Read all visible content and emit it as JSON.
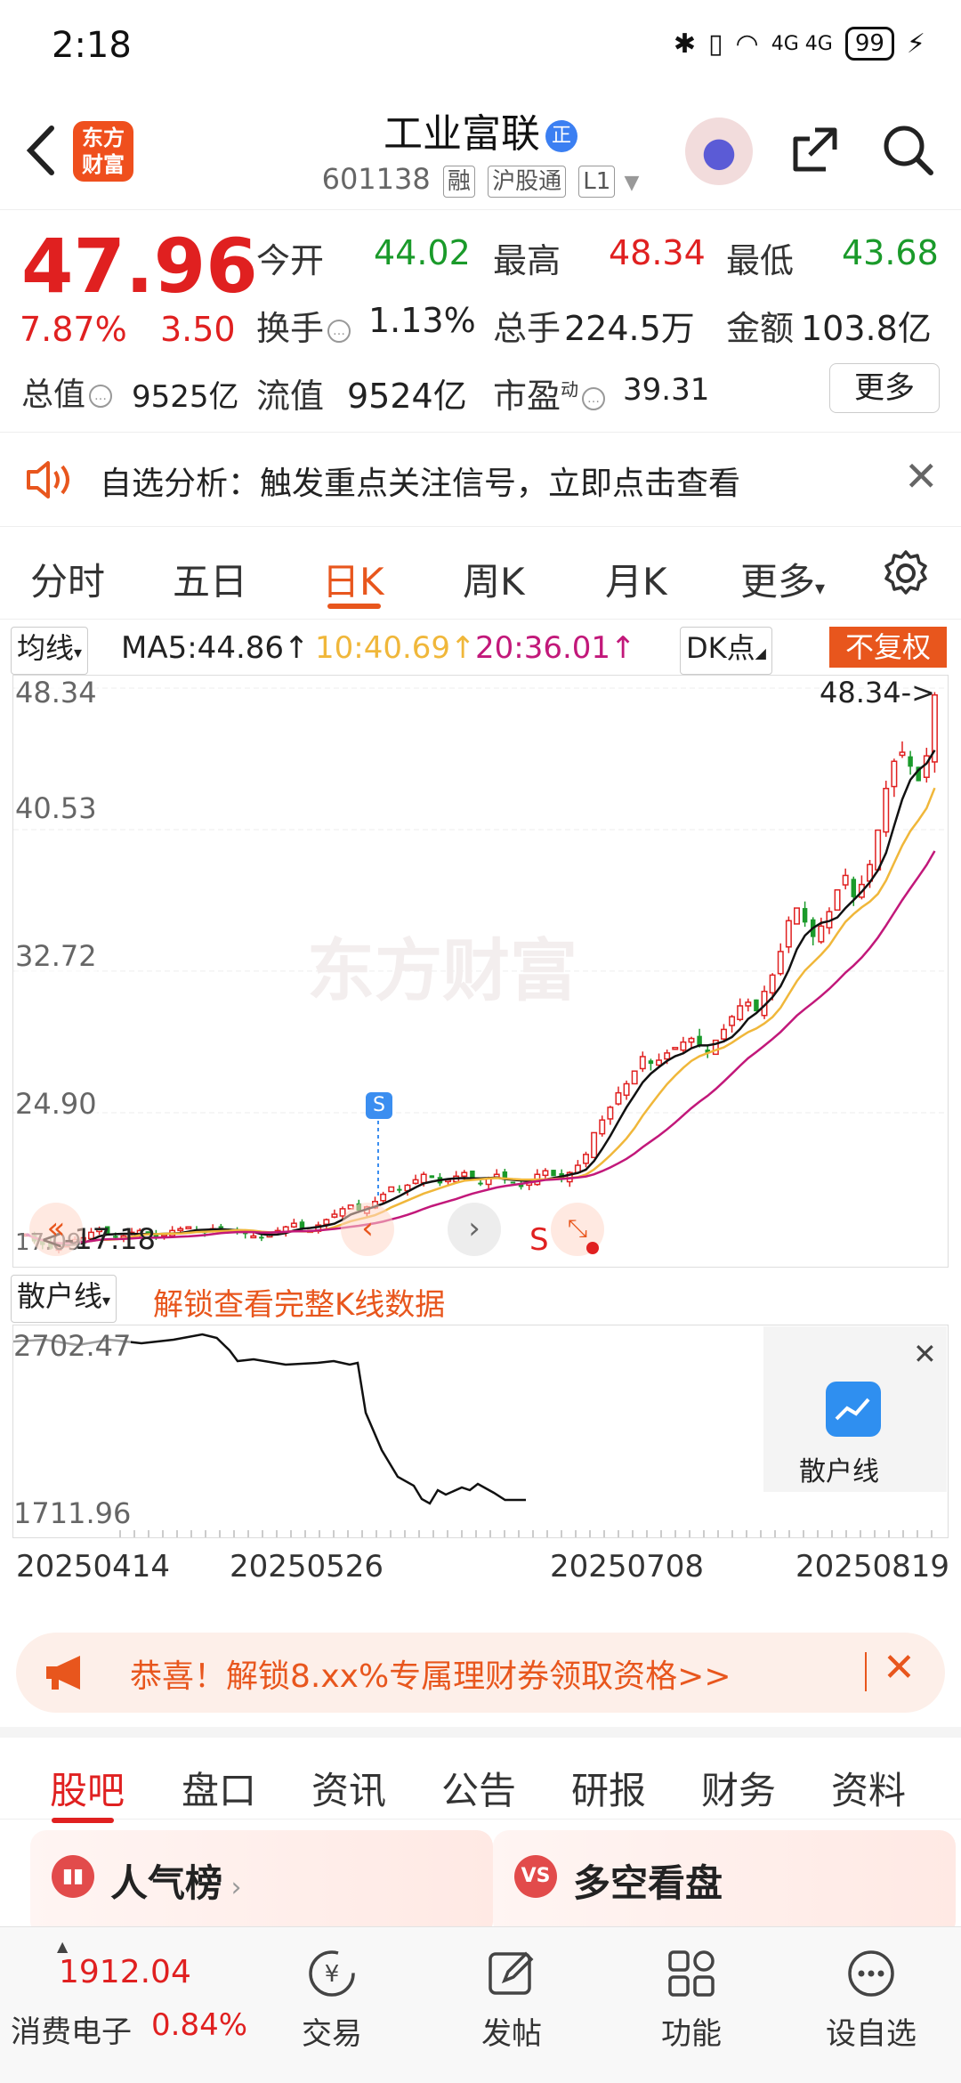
{
  "status_bar": {
    "time": "2:18",
    "network": "4G 4G",
    "battery": "99"
  },
  "header": {
    "logo_line1": "东方",
    "logo_line2": "财富",
    "stock_name": "工业富联",
    "name_badge": "正",
    "code": "601138",
    "tags": [
      "融",
      "沪股通",
      "L1"
    ]
  },
  "quote": {
    "price": "47.96",
    "change_pct": "7.87%",
    "change_abs": "3.50",
    "open_label": "今开",
    "open": "44.02",
    "high_label": "最高",
    "high": "48.34",
    "low_label": "最低",
    "low": "43.68",
    "turnover_label": "换手",
    "turnover": "1.13%",
    "volume_label": "总手",
    "volume": "224.5万",
    "amount_label": "金额",
    "amount": "103.8亿",
    "mcap_label": "总值",
    "mcap": "9525亿",
    "float_label": "流值",
    "float": "9524亿",
    "pe_label": "市盈",
    "pe_sup": "动",
    "pe": "39.31",
    "more_label": "更多"
  },
  "notice": {
    "text": "自选分析：触发重点关注信号，立即点击查看"
  },
  "period_tabs": [
    "分时",
    "五日",
    "日K",
    "周K",
    "月K",
    "更多"
  ],
  "active_period": "日K",
  "ma_row": {
    "select": "均线",
    "ma5": "MA5:44.86↑",
    "ma10": "10:40.69↑",
    "ma20": "20:36.01↑",
    "dk": "DK点",
    "fuquan": "不复权"
  },
  "colors": {
    "up": "#e02020",
    "down": "#1a9a2a",
    "accent": "#e8561d",
    "ma10": "#f0b73a",
    "ma20": "#c2187a"
  },
  "chart_data": {
    "type": "candlestick",
    "y_ticks": [
      "48.34",
      "40.53",
      "32.72",
      "24.90",
      "17.09"
    ],
    "ylim": [
      17.09,
      48.34
    ],
    "high_annotation": "48.34->",
    "low_annotation": "<-17.18",
    "signal_label": "S",
    "watermark": "东方财富",
    "closes": [
      18.2,
      17.8,
      17.6,
      17.4,
      17.5,
      17.7,
      17.9,
      18.0,
      18.3,
      18.5,
      18.2,
      18.0,
      18.1,
      18.3,
      18.4,
      18.2,
      18.0,
      18.2,
      18.4,
      18.5,
      18.6,
      18.4,
      18.3,
      18.5,
      18.6,
      18.4,
      18.3,
      18.2,
      18.1,
      18.0,
      18.2,
      18.4,
      18.6,
      18.8,
      18.5,
      18.4,
      18.7,
      19.0,
      19.3,
      19.6,
      19.8,
      19.5,
      19.7,
      20.0,
      20.4,
      20.8,
      20.6,
      20.9,
      21.2,
      21.5,
      21.3,
      21.0,
      21.2,
      21.4,
      21.6,
      21.2,
      21.0,
      21.3,
      21.5,
      21.2,
      21.0,
      20.8,
      21.1,
      21.5,
      21.7,
      21.4,
      21.2,
      21.6,
      22.0,
      22.6,
      23.8,
      24.5,
      25.2,
      26.0,
      26.5,
      27.2,
      28.0,
      27.6,
      27.8,
      28.2,
      28.5,
      28.8,
      29.0,
      28.6,
      28.2,
      28.9,
      29.5,
      30.2,
      30.8,
      31.0,
      30.5,
      31.6,
      32.5,
      33.8,
      35.5,
      36.2,
      35.4,
      34.6,
      35.2,
      36.0,
      37.2,
      38.0,
      36.8,
      37.5,
      38.6,
      40.5,
      42.8,
      44.3,
      44.8,
      44.0,
      43.2,
      44.6,
      47.96
    ]
  },
  "lower_chart": {
    "select": "散户线",
    "unlock": "解锁查看完整K线数据",
    "y_ticks": [
      "2702.47",
      "1711.96"
    ],
    "popup_label": "散户线",
    "dates": [
      "20250414",
      "20250526",
      "20250708",
      "20250819"
    ]
  },
  "banner": {
    "text": "恭喜！解锁8.xx%专属理财券领取资格>>"
  },
  "content_tabs": [
    "股吧",
    "盘口",
    "资讯",
    "公告",
    "研报",
    "财务",
    "资料"
  ],
  "cards": [
    {
      "title": "人气榜",
      "icon": "rank-icon"
    },
    {
      "title": "多空看盘",
      "icon": "vs-icon"
    }
  ],
  "bottom_nav": {
    "index_value": "1912.04",
    "index_name": "消费电子",
    "index_pct": "0.84%",
    "items": [
      "交易",
      "发帖",
      "功能",
      "设自选"
    ]
  }
}
